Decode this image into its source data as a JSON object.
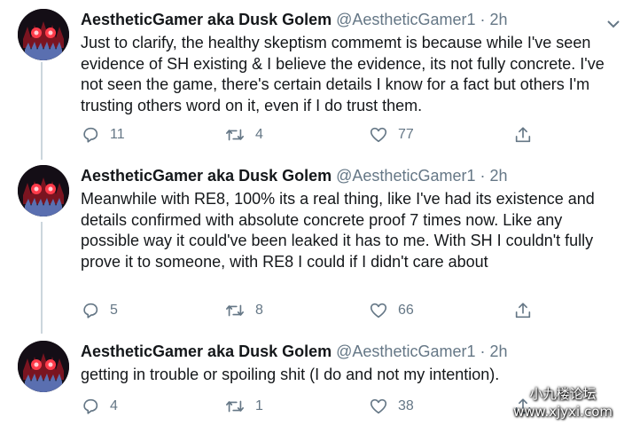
{
  "tweets": [
    {
      "author_name": "AestheticGamer aka Dusk Golem",
      "handle": "@AestheticGamer1",
      "separator": "·",
      "time": "2h",
      "text": "Just to clarify, the healthy skeptism commemt is because while I've seen evidence of SH existing & I believe the evidence, its not fully concrete. I've not seen the game, there's certain details I know for a fact but others I'm trusting others word on it, even if I do trust them.",
      "replies": "11",
      "retweets": "4",
      "likes": "77"
    },
    {
      "author_name": "AestheticGamer aka Dusk Golem",
      "handle": "@AestheticGamer1",
      "separator": "·",
      "time": "2h",
      "text": "Meanwhile with RE8, 100% its a real thing, like I've had its existence and details confirmed with absolute concrete proof 7 times now. Like any possible way it could've been leaked it has to me. With SH I couldn't fully prove it to someone, with RE8 I could if I didn't care about",
      "replies": "5",
      "retweets": "8",
      "likes": "66"
    },
    {
      "author_name": "AestheticGamer aka Dusk Golem",
      "handle": "@AestheticGamer1",
      "separator": "·",
      "time": "2h",
      "text": "getting in trouble or spoiling shit (I do and not my intention).",
      "replies": "4",
      "retweets": "1",
      "likes": "38"
    }
  ],
  "icons": {
    "reply": "reply-icon",
    "retweet": "retweet-icon",
    "like": "heart-icon",
    "share": "share-icon",
    "menu": "chevron-down-icon"
  },
  "watermark": {
    "line1": "小九楼论坛",
    "line2": "www.xjyxi.com"
  },
  "colors": {
    "text": "#14171a",
    "secondary": "#657786",
    "thread_line": "#ccd6dd"
  }
}
